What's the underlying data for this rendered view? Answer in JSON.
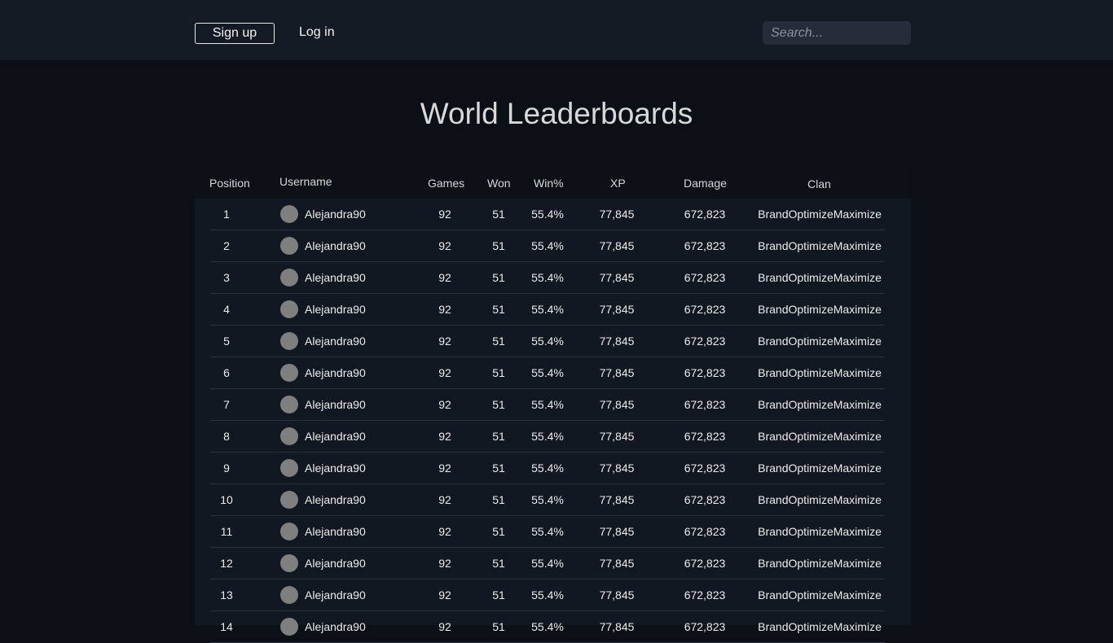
{
  "header": {
    "signup_label": "Sign up",
    "login_label": "Log in",
    "search_placeholder": "Search..."
  },
  "page": {
    "title": "World Leaderboards"
  },
  "table": {
    "columns": [
      "Position",
      "Username",
      "Games",
      "Won",
      "Win%",
      "XP",
      "Damage",
      "Clan"
    ],
    "rows": [
      {
        "position": "1",
        "username": "Alejandra90",
        "games": "92",
        "won": "51",
        "win_pct": "55.4%",
        "xp": "77,845",
        "damage": "672,823",
        "clan": "BrandOptimizeMaximize"
      },
      {
        "position": "2",
        "username": "Alejandra90",
        "games": "92",
        "won": "51",
        "win_pct": "55.4%",
        "xp": "77,845",
        "damage": "672,823",
        "clan": "BrandOptimizeMaximize"
      },
      {
        "position": "3",
        "username": "Alejandra90",
        "games": "92",
        "won": "51",
        "win_pct": "55.4%",
        "xp": "77,845",
        "damage": "672,823",
        "clan": "BrandOptimizeMaximize"
      },
      {
        "position": "4",
        "username": "Alejandra90",
        "games": "92",
        "won": "51",
        "win_pct": "55.4%",
        "xp": "77,845",
        "damage": "672,823",
        "clan": "BrandOptimizeMaximize"
      },
      {
        "position": "5",
        "username": "Alejandra90",
        "games": "92",
        "won": "51",
        "win_pct": "55.4%",
        "xp": "77,845",
        "damage": "672,823",
        "clan": "BrandOptimizeMaximize"
      },
      {
        "position": "6",
        "username": "Alejandra90",
        "games": "92",
        "won": "51",
        "win_pct": "55.4%",
        "xp": "77,845",
        "damage": "672,823",
        "clan": "BrandOptimizeMaximize"
      },
      {
        "position": "7",
        "username": "Alejandra90",
        "games": "92",
        "won": "51",
        "win_pct": "55.4%",
        "xp": "77,845",
        "damage": "672,823",
        "clan": "BrandOptimizeMaximize"
      },
      {
        "position": "8",
        "username": "Alejandra90",
        "games": "92",
        "won": "51",
        "win_pct": "55.4%",
        "xp": "77,845",
        "damage": "672,823",
        "clan": "BrandOptimizeMaximize"
      },
      {
        "position": "9",
        "username": "Alejandra90",
        "games": "92",
        "won": "51",
        "win_pct": "55.4%",
        "xp": "77,845",
        "damage": "672,823",
        "clan": "BrandOptimizeMaximize"
      },
      {
        "position": "10",
        "username": "Alejandra90",
        "games": "92",
        "won": "51",
        "win_pct": "55.4%",
        "xp": "77,845",
        "damage": "672,823",
        "clan": "BrandOptimizeMaximize"
      },
      {
        "position": "11",
        "username": "Alejandra90",
        "games": "92",
        "won": "51",
        "win_pct": "55.4%",
        "xp": "77,845",
        "damage": "672,823",
        "clan": "BrandOptimizeMaximize"
      },
      {
        "position": "12",
        "username": "Alejandra90",
        "games": "92",
        "won": "51",
        "win_pct": "55.4%",
        "xp": "77,845",
        "damage": "672,823",
        "clan": "BrandOptimizeMaximize"
      },
      {
        "position": "13",
        "username": "Alejandra90",
        "games": "92",
        "won": "51",
        "win_pct": "55.4%",
        "xp": "77,845",
        "damage": "672,823",
        "clan": "BrandOptimizeMaximize"
      },
      {
        "position": "14",
        "username": "Alejandra90",
        "games": "92",
        "won": "51",
        "win_pct": "55.4%",
        "xp": "77,845",
        "damage": "672,823",
        "clan": "BrandOptimizeMaximize"
      }
    ]
  },
  "colors": {
    "background": "#0b1017",
    "topbar": "#151b24",
    "table_header": "#0c1118",
    "table_body": "#111821",
    "row_divider": "#2b323c",
    "avatar": "#7f7f7f"
  }
}
